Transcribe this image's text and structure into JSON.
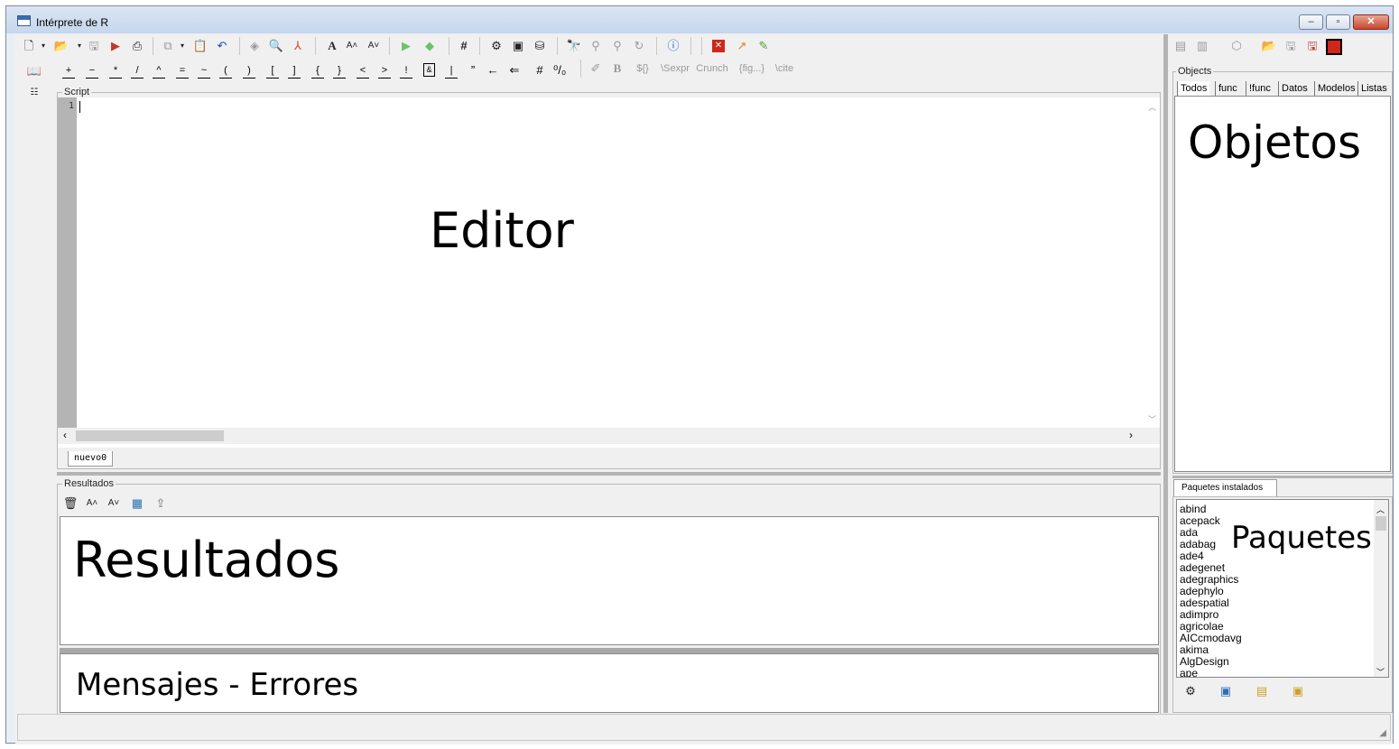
{
  "window": {
    "title": "Intérprete de R",
    "min_label": "–",
    "max_label": "▫",
    "close_label": "✕"
  },
  "symbol_toolbar": [
    "+",
    "−",
    "*",
    "/",
    "^",
    "=",
    "~",
    "(",
    ")",
    "[",
    "]",
    "{",
    "}",
    "<",
    ">",
    "!",
    "&",
    "|",
    "”",
    "←",
    "⇐",
    "#",
    "⁰/₀"
  ],
  "latex_toolbar": {
    "bold": "B",
    "sexpr_braces": "${}",
    "sexpr": "\\Sexpr",
    "crunch": "Crunch",
    "fig": "{fig...}",
    "cite": "\\cite"
  },
  "editor": {
    "group_label": "Script",
    "line_number": "1",
    "big_label": "Editor",
    "tab": "nuevo0"
  },
  "results": {
    "group_label": "Resultados",
    "big_label": "Resultados",
    "messages_label": "Mensajes - Errores"
  },
  "objects": {
    "group_label": "Objects",
    "tabs": [
      "Todos",
      "func",
      "!func",
      "Datos",
      "Modelos",
      "Listas"
    ],
    "big_label": "Objetos"
  },
  "packages": {
    "tab": "Paquetes instalados",
    "big_label": "Paquetes",
    "items": [
      "abind",
      "acepack",
      "ada",
      "adabag",
      "ade4",
      "adegenet",
      "adegraphics",
      "adephylo",
      "adespatial",
      "adimpro",
      "agricolae",
      "AICcmodavg",
      "akima",
      "AlgDesign",
      "ape"
    ]
  },
  "colors": {
    "titlebar": "#c6d6ec",
    "panel": "#f0f0f0",
    "gutter": "#b4b4b4",
    "close": "#c9462c"
  }
}
